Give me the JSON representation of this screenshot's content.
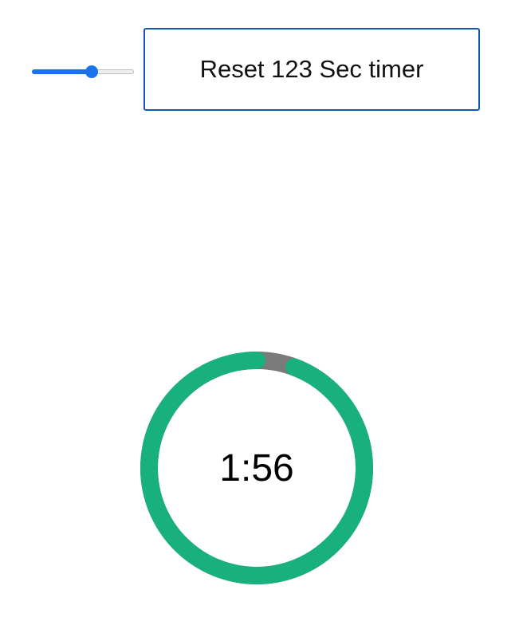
{
  "slider": {
    "value_fraction": 0.6,
    "accent_color": "#1a73e8"
  },
  "reset_button": {
    "label": "Reset 123 Sec timer"
  },
  "timer": {
    "display": "1:56",
    "total_seconds": 123,
    "remaining_seconds": 116,
    "progress_color": "#18b07c",
    "elapsed_color": "#7a7a7a"
  }
}
